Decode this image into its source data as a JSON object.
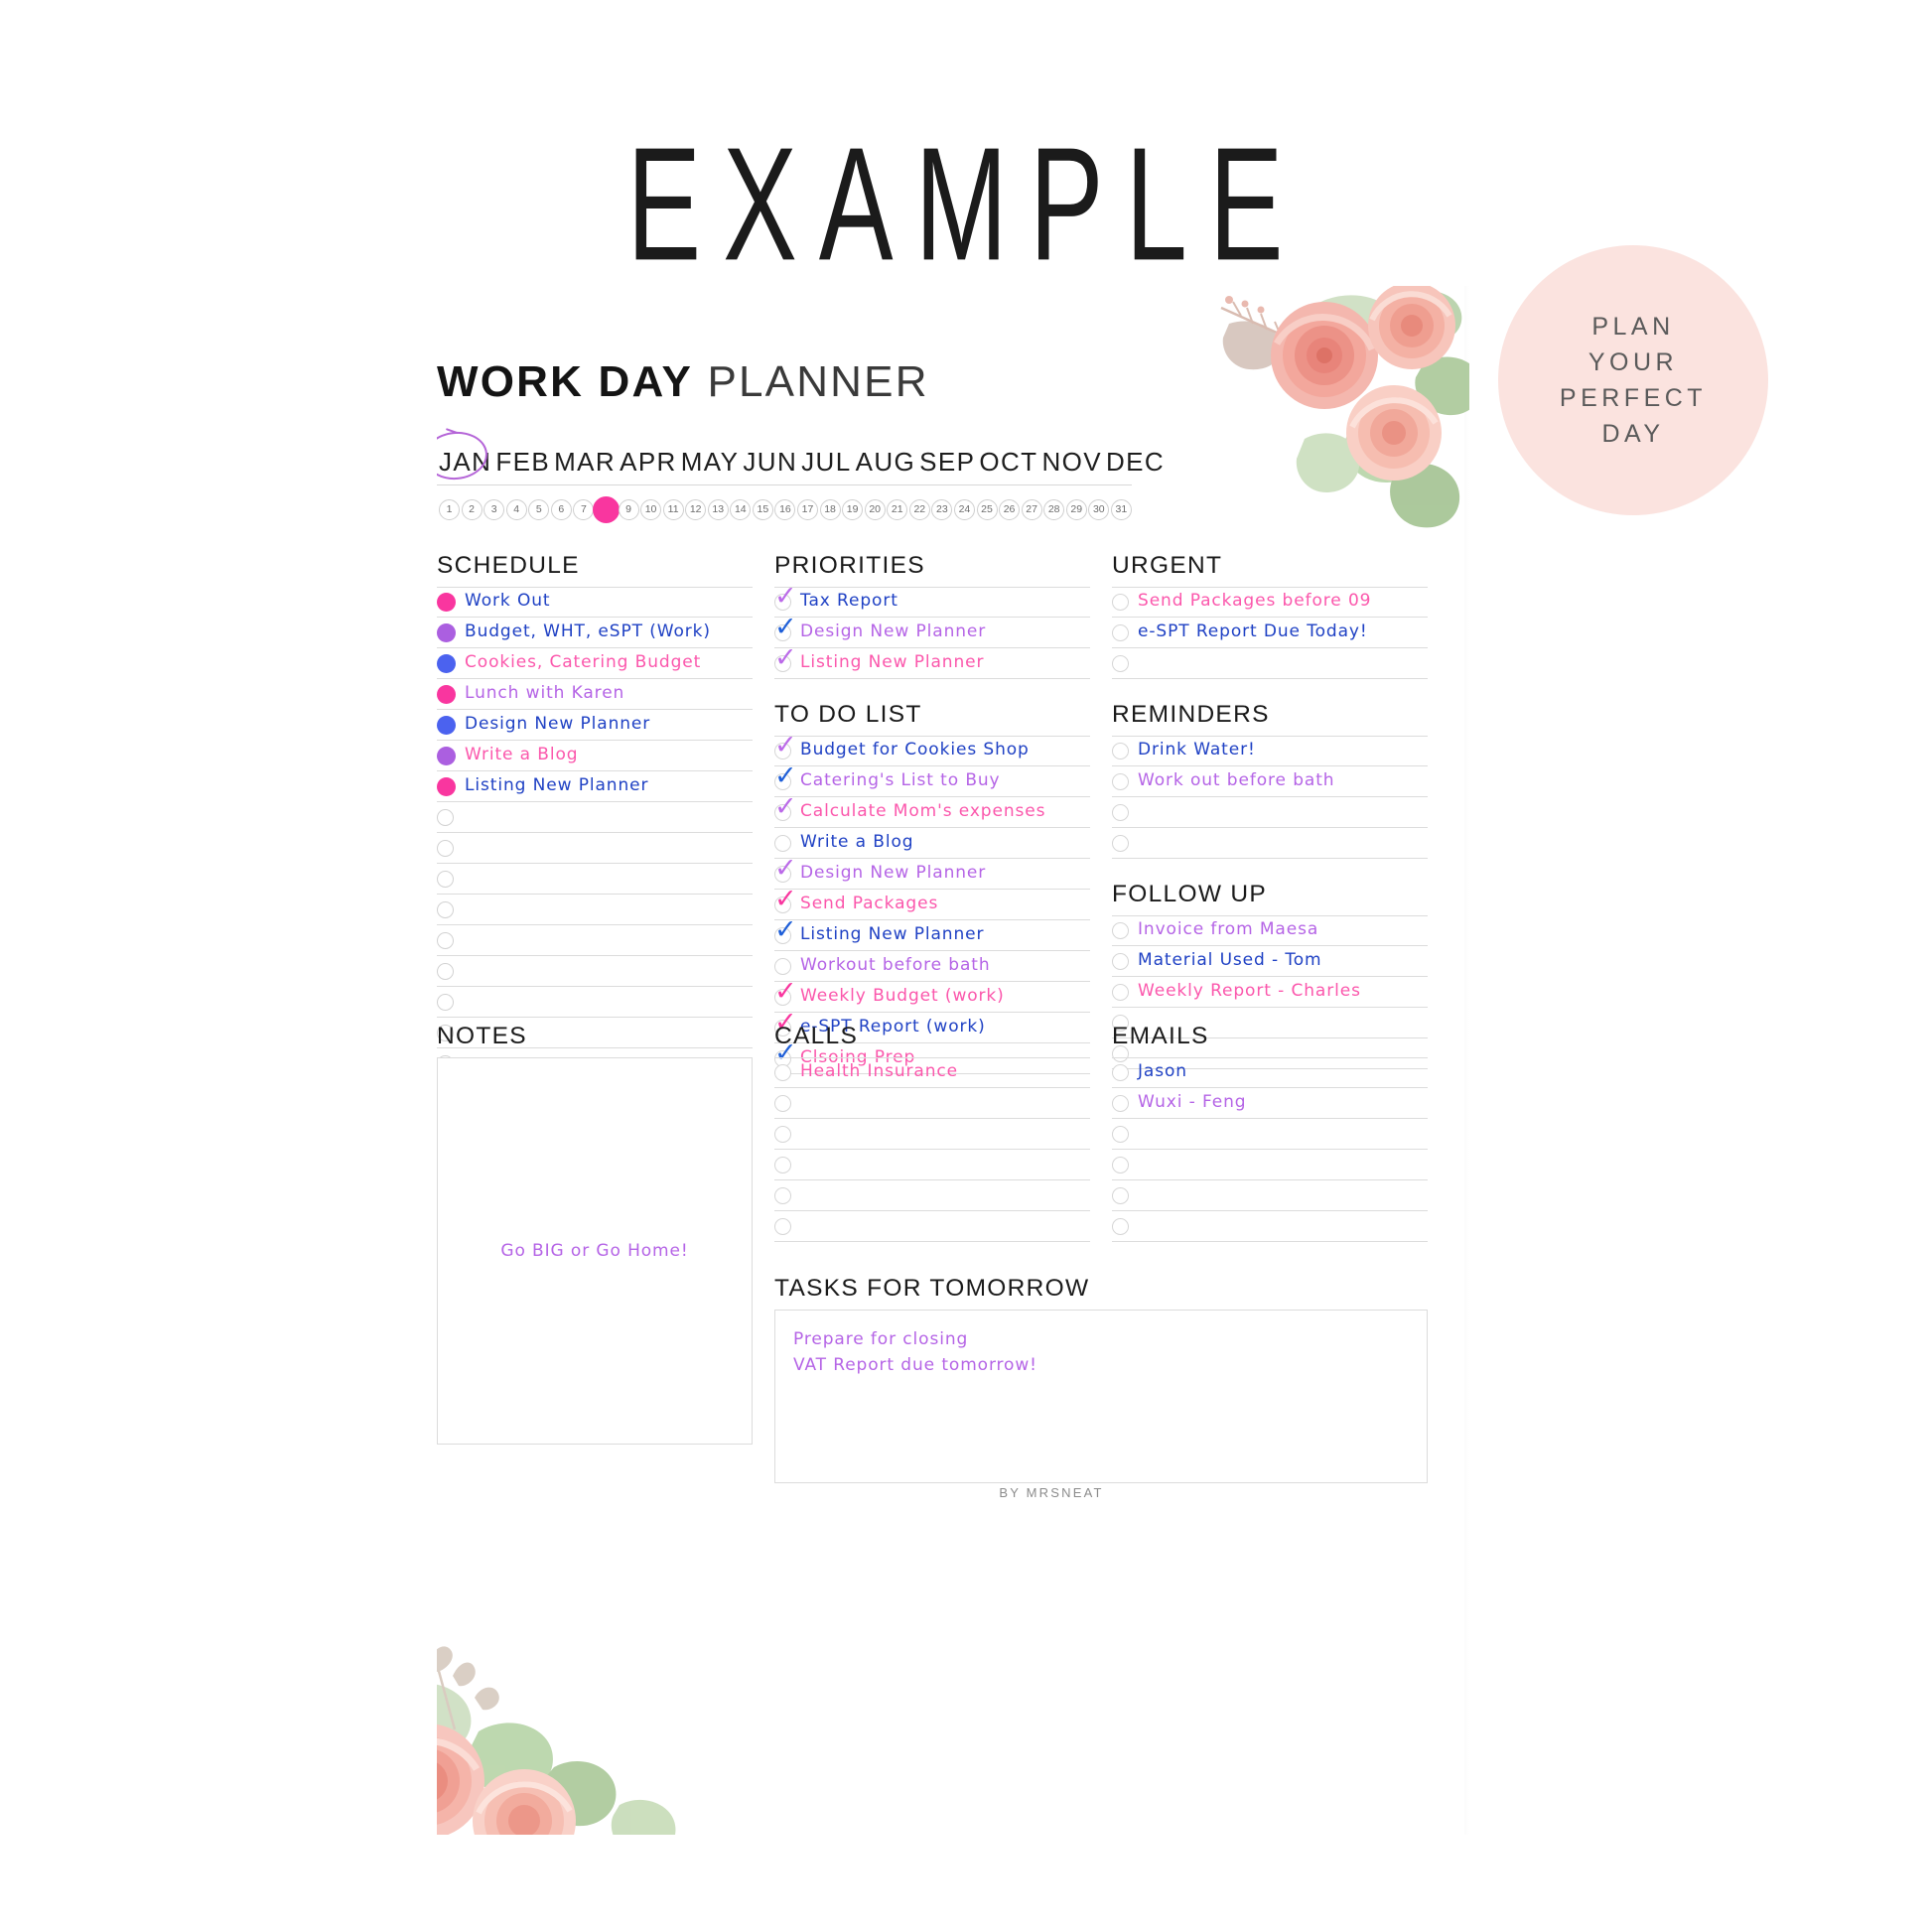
{
  "watermark": {
    "text": "EXAMPLE"
  },
  "badge": {
    "lines": [
      "PLAN",
      "YOUR",
      "PERFECT",
      "DAY"
    ],
    "bg_color": "#fbe3df"
  },
  "header": {
    "title_bold": "WORK DAY",
    "title_light": "PLANNER"
  },
  "calendar": {
    "months": [
      "JAN",
      "FEB",
      "MAR",
      "APR",
      "MAY",
      "JUN",
      "JUL",
      "AUG",
      "SEP",
      "OCT",
      "NOV",
      "DEC"
    ],
    "selected_month": "JAN",
    "days": [
      1,
      2,
      3,
      4,
      5,
      6,
      7,
      8,
      9,
      10,
      11,
      12,
      13,
      14,
      15,
      16,
      17,
      18,
      19,
      20,
      21,
      22,
      23,
      24,
      25,
      26,
      27,
      28,
      29,
      30,
      31
    ],
    "selected_day": 8,
    "selected_day_color": "#f9369f",
    "month_circle_color": "#b565d8"
  },
  "colors": {
    "pink": "#f9369f",
    "purple": "#ab5fe0",
    "blue": "#4b62ef",
    "text_blue": "#1f41c4",
    "text_pink": "#fb57ac",
    "text_purple": "#b564e6"
  },
  "schedule": {
    "title": "SCHEDULE",
    "items": [
      {
        "label": "Work Out",
        "bullet": "pink",
        "text_color": "blue"
      },
      {
        "label": "Budget, WHT, eSPT (Work)",
        "bullet": "purple",
        "text_color": "blue"
      },
      {
        "label": "Cookies, Catering Budget",
        "bullet": "blue",
        "text_color": "pink"
      },
      {
        "label": "Lunch with Karen",
        "bullet": "pink",
        "text_color": "purple"
      },
      {
        "label": "Design New Planner",
        "bullet": "blue",
        "text_color": "blue"
      },
      {
        "label": "Write a Blog",
        "bullet": "purple",
        "text_color": "pink"
      },
      {
        "label": "Listing New Planner",
        "bullet": "pink",
        "text_color": "blue"
      },
      {
        "label": "",
        "bullet": "empty",
        "text_color": "blue"
      },
      {
        "label": "",
        "bullet": "empty",
        "text_color": "blue"
      },
      {
        "label": "",
        "bullet": "empty",
        "text_color": "blue"
      },
      {
        "label": "",
        "bullet": "empty",
        "text_color": "blue"
      },
      {
        "label": "",
        "bullet": "empty",
        "text_color": "blue"
      },
      {
        "label": "",
        "bullet": "empty",
        "text_color": "blue"
      },
      {
        "label": "",
        "bullet": "empty",
        "text_color": "blue"
      },
      {
        "label": "",
        "bullet": "empty",
        "text_color": "blue"
      },
      {
        "label": "",
        "bullet": "empty",
        "text_color": "blue"
      }
    ]
  },
  "priorities": {
    "title": "PRIORITIES",
    "items": [
      {
        "label": "Tax Report",
        "checked": true,
        "check_color": "purple",
        "text_color": "blue"
      },
      {
        "label": "Design New Planner",
        "checked": true,
        "check_color": "blue",
        "text_color": "purple"
      },
      {
        "label": "Listing New Planner",
        "checked": true,
        "check_color": "purple",
        "text_color": "pink"
      }
    ]
  },
  "todo": {
    "title": "TO DO LIST",
    "items": [
      {
        "label": "Budget for Cookies Shop",
        "checked": true,
        "check_color": "purple",
        "text_color": "blue"
      },
      {
        "label": "Catering's List to Buy",
        "checked": true,
        "check_color": "blue",
        "text_color": "purple"
      },
      {
        "label": "Calculate Mom's expenses",
        "checked": true,
        "check_color": "purple",
        "text_color": "pink"
      },
      {
        "label": "Write a Blog",
        "checked": false,
        "check_color": "blue",
        "text_color": "blue"
      },
      {
        "label": "Design New Planner",
        "checked": true,
        "check_color": "purple",
        "text_color": "purple"
      },
      {
        "label": "Send Packages",
        "checked": true,
        "check_color": "pink",
        "text_color": "pink"
      },
      {
        "label": "Listing New Planner",
        "checked": true,
        "check_color": "blue",
        "text_color": "blue"
      },
      {
        "label": "Workout before bath",
        "checked": false,
        "check_color": "purple",
        "text_color": "purple"
      },
      {
        "label": "Weekly Budget (work)",
        "checked": true,
        "check_color": "pink",
        "text_color": "pink"
      },
      {
        "label": "e-SPT Report (work)",
        "checked": true,
        "check_color": "pink",
        "text_color": "blue"
      },
      {
        "label": "Clsoing Prep",
        "checked": true,
        "check_color": "blue",
        "text_color": "pink"
      }
    ]
  },
  "urgent": {
    "title": "URGENT",
    "items": [
      {
        "label": "Send Packages before 09",
        "checked": false,
        "text_color": "pink"
      },
      {
        "label": "e-SPT Report Due Today!",
        "checked": false,
        "text_color": "blue"
      },
      {
        "label": "",
        "checked": false,
        "text_color": "blue"
      }
    ]
  },
  "reminders": {
    "title": "REMINDERS",
    "items": [
      {
        "label": "Drink Water!",
        "checked": false,
        "text_color": "blue"
      },
      {
        "label": "Work out before bath",
        "checked": false,
        "text_color": "purple"
      },
      {
        "label": "",
        "checked": false,
        "text_color": "blue"
      },
      {
        "label": "",
        "checked": false,
        "text_color": "blue"
      }
    ]
  },
  "followup": {
    "title": "FOLLOW UP",
    "items": [
      {
        "label": "Invoice from Maesa",
        "checked": false,
        "text_color": "purple"
      },
      {
        "label": "Material Used - Tom",
        "checked": false,
        "text_color": "blue"
      },
      {
        "label": "Weekly Report - Charles",
        "checked": false,
        "text_color": "pink"
      },
      {
        "label": "",
        "checked": false,
        "text_color": "blue"
      },
      {
        "label": "",
        "checked": false,
        "text_color": "blue"
      }
    ]
  },
  "notes": {
    "title": "NOTES",
    "content": "Go BIG or Go Home!"
  },
  "calls": {
    "title": "CALLS",
    "items": [
      {
        "label": "Health Insurance",
        "checked": false,
        "text_color": "pink"
      },
      {
        "label": "",
        "checked": false,
        "text_color": "blue"
      },
      {
        "label": "",
        "checked": false,
        "text_color": "blue"
      },
      {
        "label": "",
        "checked": false,
        "text_color": "blue"
      },
      {
        "label": "",
        "checked": false,
        "text_color": "blue"
      },
      {
        "label": "",
        "checked": false,
        "text_color": "blue"
      }
    ]
  },
  "emails": {
    "title": "EMAILS",
    "items": [
      {
        "label": "Jason",
        "checked": false,
        "text_color": "blue"
      },
      {
        "label": "Wuxi - Feng",
        "checked": false,
        "text_color": "purple"
      },
      {
        "label": "",
        "checked": false,
        "text_color": "blue"
      },
      {
        "label": "",
        "checked": false,
        "text_color": "blue"
      },
      {
        "label": "",
        "checked": false,
        "text_color": "blue"
      },
      {
        "label": "",
        "checked": false,
        "text_color": "blue"
      }
    ]
  },
  "tomorrow": {
    "title": "TASKS FOR TOMORROW",
    "content": "Prepare for closing\nVAT Report due tomorrow!"
  },
  "footer": {
    "text": "BY MRSNEAT"
  }
}
